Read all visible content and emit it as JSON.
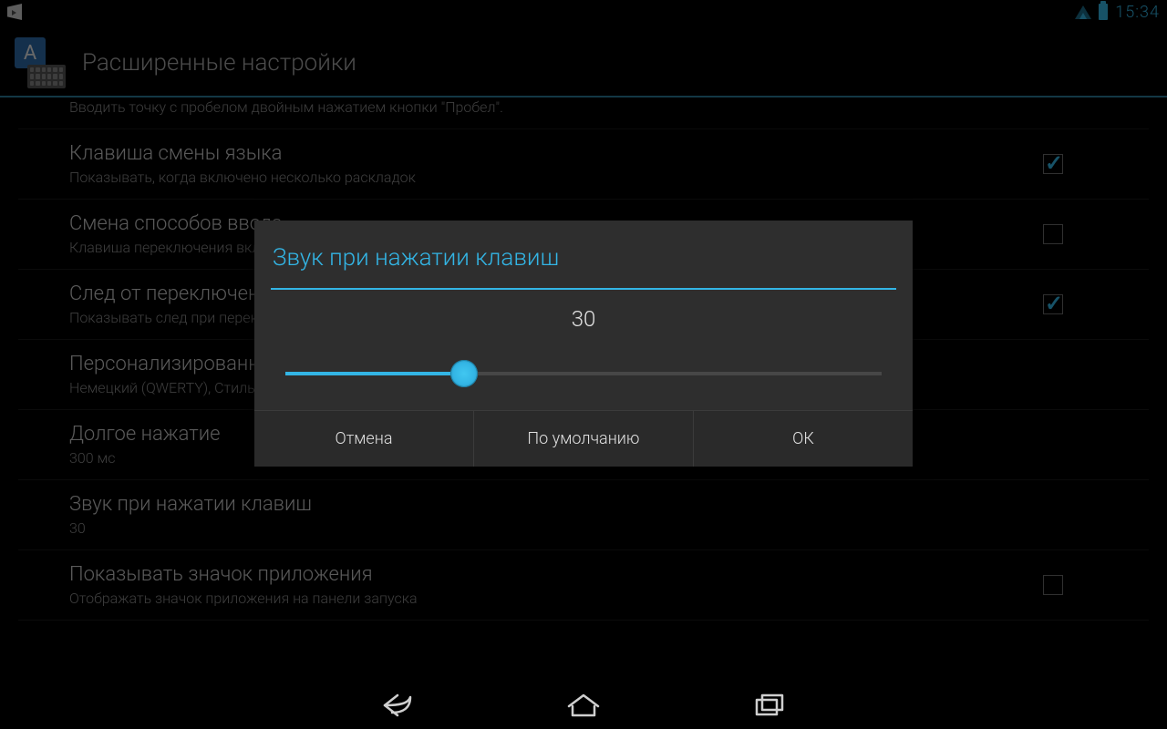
{
  "statusbar": {
    "time": "15:34"
  },
  "header": {
    "title": "Расширенные настройки"
  },
  "settings": [
    {
      "title": "",
      "subtitle": "Вводить точку с пробелом двойным нажатием кнопки \"Пробел\"."
    },
    {
      "title": "Клавиша смены языка",
      "subtitle": "Показывать, когда включено несколько раскладок",
      "checked": true
    },
    {
      "title": "Смена способов ввода",
      "subtitle": "Клавиша переключения включает и другие способы ввода",
      "unchecked": true
    },
    {
      "title": "След от переключения",
      "subtitle": "Показывать след при переключении",
      "checked": true
    },
    {
      "title": "Персонализированные стили",
      "subtitle": "Немецкий (QWERTY), Стиль: QWERTY"
    },
    {
      "title": "Долгое нажатие",
      "subtitle": "300 мс"
    },
    {
      "title": "Звук при нажатии клавиш",
      "subtitle": "30"
    },
    {
      "title": "Показывать значок приложения",
      "subtitle": "Отображать значок приложения на панели запуска",
      "unchecked": true
    }
  ],
  "dialog": {
    "title": "Звук при нажатии клавиш",
    "value": "30",
    "slider_percent": 30,
    "buttons": {
      "cancel": "Отмена",
      "default": "По умолчанию",
      "ok": "ОК"
    }
  }
}
